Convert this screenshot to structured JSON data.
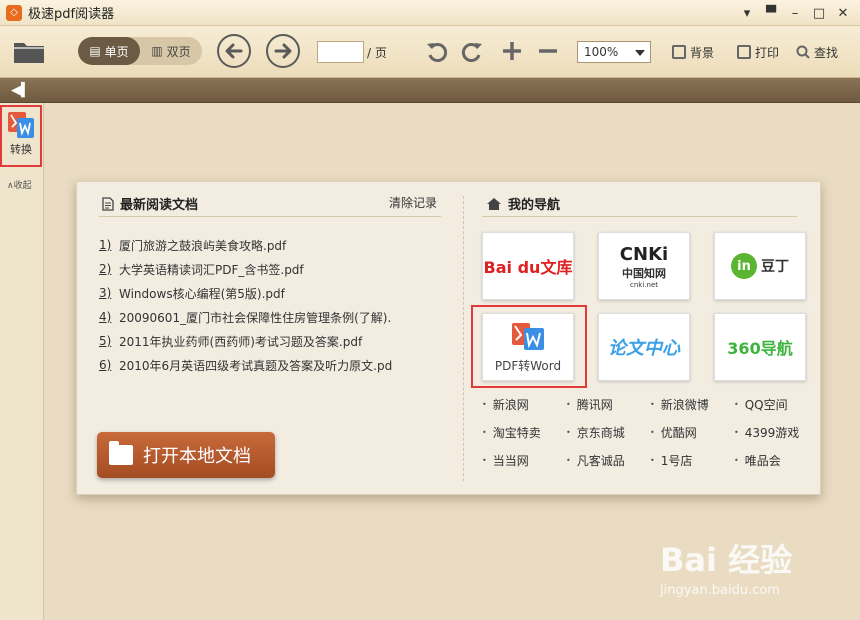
{
  "window": {
    "app_title": "极速pdf阅读器",
    "logo_glyph": "◇"
  },
  "toolbar": {
    "single_page_label": "单页",
    "double_page_label": "双页",
    "page_value": "",
    "page_suffix": "/ 页",
    "zoom_value": "100%",
    "background_label": "背景",
    "print_label": "打印",
    "find_label": "查找"
  },
  "sidebar": {
    "convert_label": "转换",
    "collapse_label": "∧收起"
  },
  "recent": {
    "header": "最新阅读文档",
    "clear_label": "清除记录",
    "items": [
      {
        "num": "1)",
        "name": "厦门旅游之鼓浪屿美食攻略.pdf"
      },
      {
        "num": "2)",
        "name": "大学英语精读词汇PDF_含书签.pdf"
      },
      {
        "num": "3)",
        "name": "Windows核心编程(第5版).pdf"
      },
      {
        "num": "4)",
        "name": "20090601_厦门市社会保障性住房管理条例(了解)."
      },
      {
        "num": "5)",
        "name": "2011年执业药师(西药师)考试习题及答案.pdf"
      },
      {
        "num": "6)",
        "name": "2010年6月英语四级考试真题及答案及听力原文.pd"
      }
    ],
    "open_button_label": "打开本地文档"
  },
  "nav": {
    "header": "我的导航",
    "tiles": {
      "baidu": "Bai du文库",
      "cnki_top": "CNKi",
      "cnki_mid": "中国知网",
      "cnki_bottom": "cnki.net",
      "indoing": "豆丁",
      "pdf2word": "PDF转Word",
      "lunwen": "论文中心",
      "nav360": "360导航"
    },
    "links": [
      "新浪网",
      "腾讯网",
      "新浪微博",
      "QQ空间",
      "淘宝特卖",
      "京东商城",
      "优酷网",
      "4399游戏",
      "当当网",
      "凡客诚品",
      "1号店",
      "唯品会"
    ]
  },
  "watermark": {
    "main": "Bai 经验",
    "sub": "jingyan.baidu.com"
  },
  "colors": {
    "accent": "#a44c23",
    "highlight": "#e03a3a",
    "brand_orange": "#e96b1e"
  }
}
